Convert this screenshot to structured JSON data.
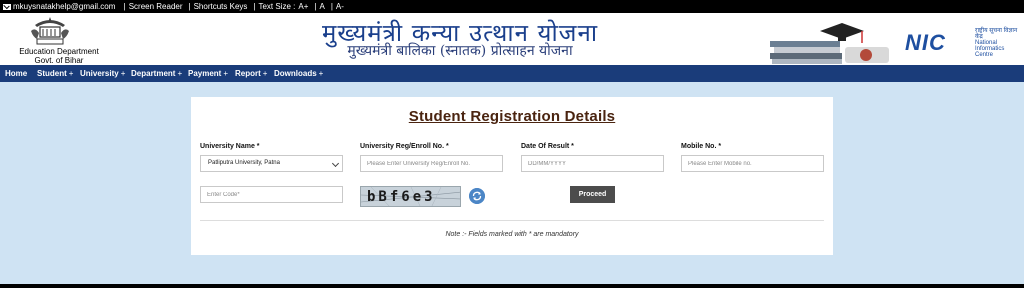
{
  "topbar": {
    "email": "mkuysnatakhelp@gmail.com",
    "screen_reader": "Screen Reader",
    "shortcuts": "Shortcuts Keys",
    "text_size_label": "Text Size :",
    "text_size_plus": "A+",
    "text_size_normal": "A",
    "text_size_minus": "A-"
  },
  "header": {
    "title": "मुख्यमंत्री कन्या उत्थान योजना",
    "subtitle": "मुख्यमंत्री बालिका (स्नातक) प्रोत्साहन योजना",
    "dept_line1": "Education Department",
    "dept_line2": "Govt. of Bihar",
    "nic_logo": "NIC",
    "nic_hindi": "राष्ट्रीय सूचना विज्ञान केंद्र",
    "nic_english": "National Informatics Centre"
  },
  "nav": {
    "items": [
      {
        "label": "Home",
        "plus": ""
      },
      {
        "label": "Student",
        "plus": "+"
      },
      {
        "label": "University",
        "plus": "+"
      },
      {
        "label": "Department",
        "plus": "+"
      },
      {
        "label": "Payment",
        "plus": "+"
      },
      {
        "label": "Report",
        "plus": "+"
      },
      {
        "label": "Downloads",
        "plus": "+"
      }
    ]
  },
  "form": {
    "title": "Student Registration Details",
    "university_label": "University Name *",
    "university_value": "Patliputra University, Patna",
    "reg_label": "University Reg/Enroll No. *",
    "reg_placeholder": "Please Enter University Reg/Enroll No.",
    "result_label": "Date Of Result *",
    "result_placeholder": "DD/MM/YYYY",
    "mobile_label": "Mobile No. *",
    "mobile_placeholder": "Please Enter Mobile no.",
    "code_placeholder": "Enter Code*",
    "captcha_text": "bBf6e3",
    "proceed_label": "Proceed",
    "note": "Note :- Fields marked with * are mandatory"
  },
  "colors": {
    "nav_bg": "#1a3c7a",
    "page_bg": "#cfe3f3",
    "title_color": "#4a2410",
    "proceed_bg": "#4c4c4c"
  }
}
